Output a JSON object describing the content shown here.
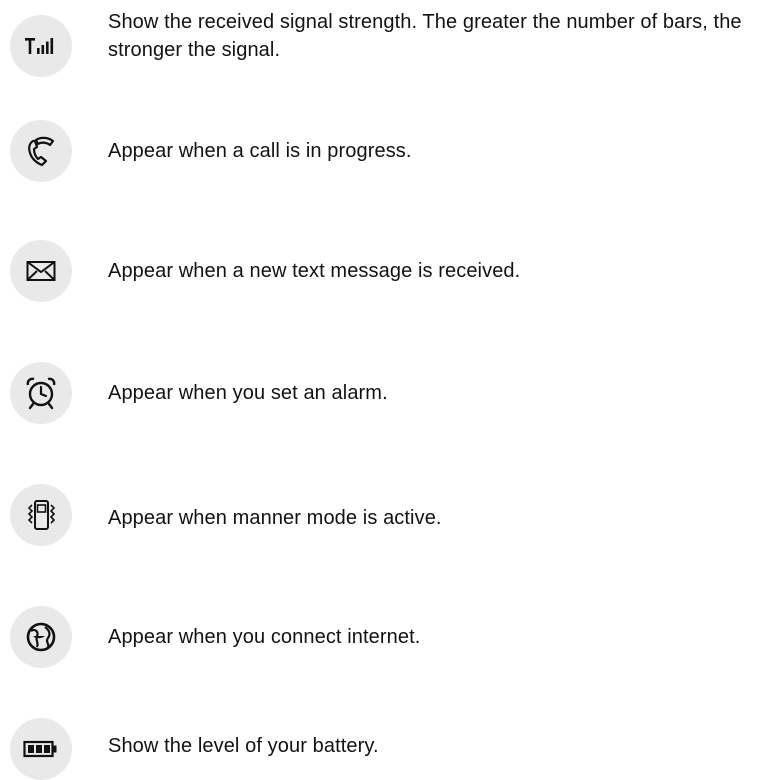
{
  "icons": [
    {
      "icon": "signal-strength-icon",
      "text": "Show the received signal strength. The greater the number of bars, the stronger the signal."
    },
    {
      "icon": "phone-call-icon",
      "text": "Appear when a call is in progress."
    },
    {
      "icon": "envelope-icon",
      "text": "Appear when a new text message is received."
    },
    {
      "icon": "alarm-clock-icon",
      "text": "Appear when you set an alarm."
    },
    {
      "icon": "vibrate-mode-icon",
      "text": "Appear when manner mode is active."
    },
    {
      "icon": "globe-icon",
      "text": "Appear when you connect internet."
    },
    {
      "icon": "battery-icon",
      "text": "Show the level of your battery."
    }
  ],
  "colors": {
    "icon_background": "#e9e9e9",
    "icon_stroke": "#111111",
    "text": "#121212"
  }
}
